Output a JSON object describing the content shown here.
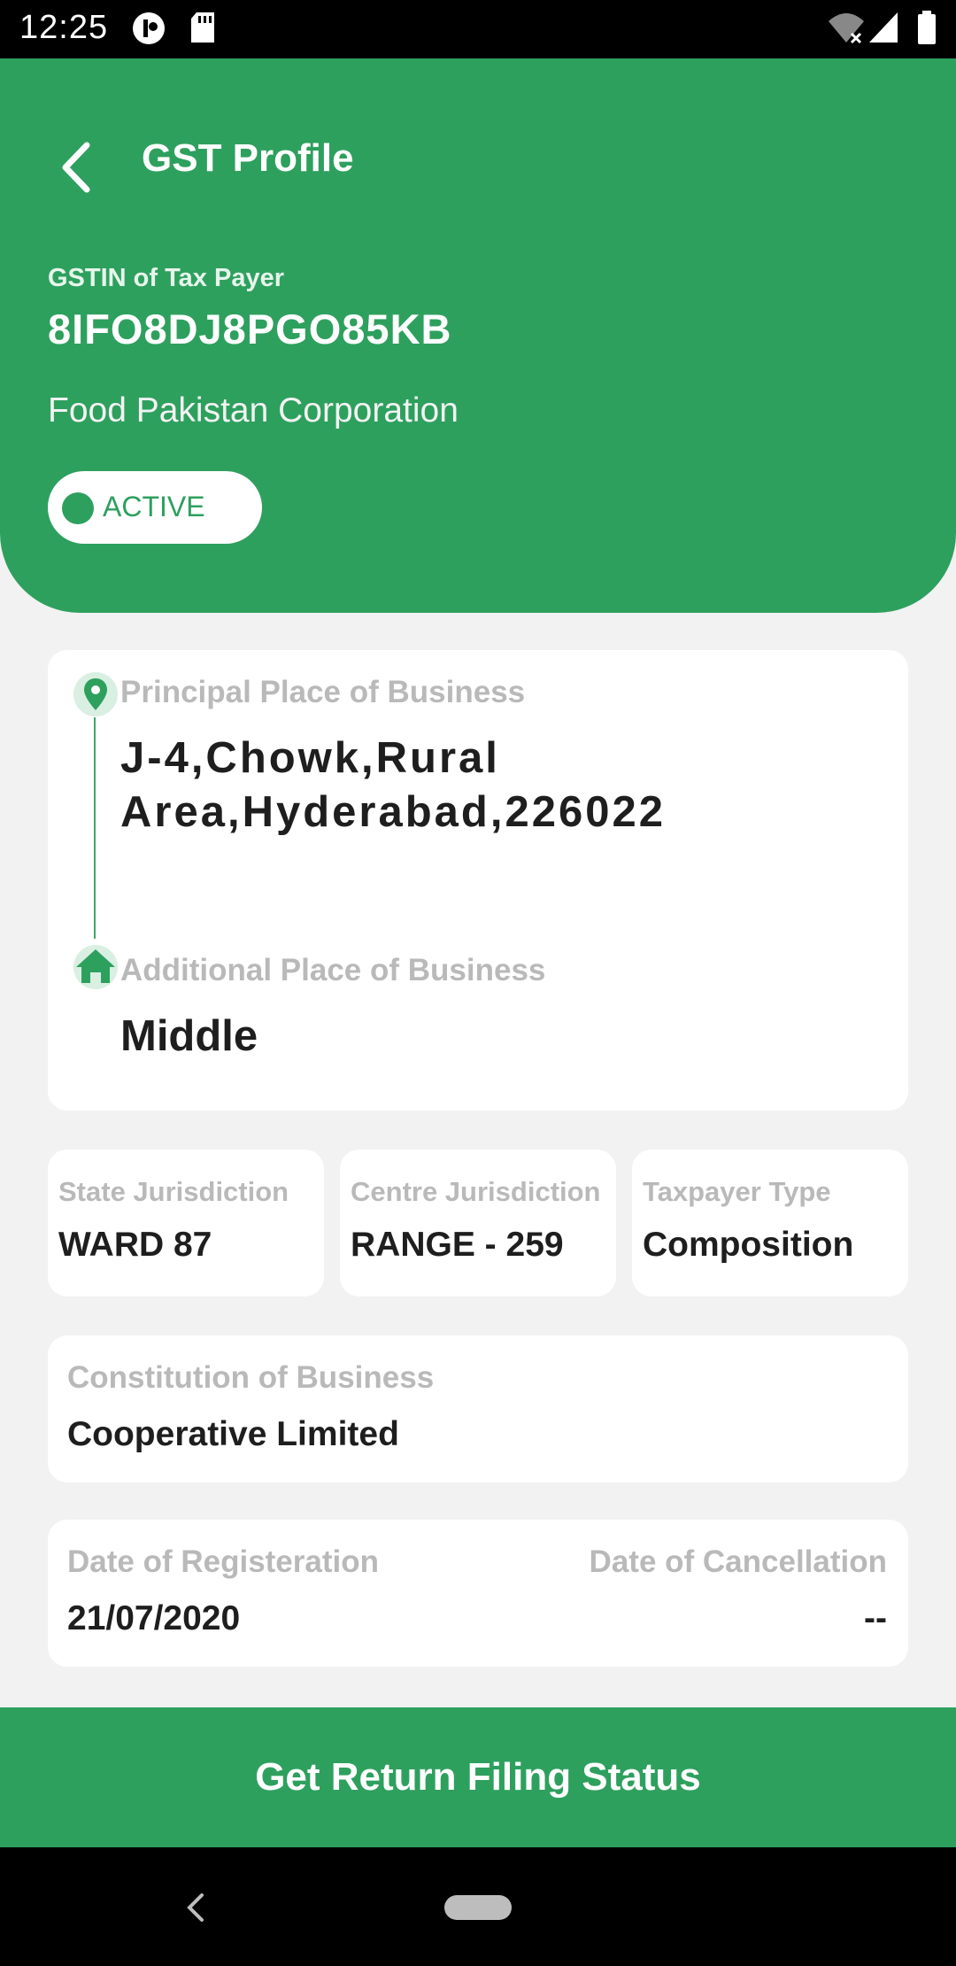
{
  "status_bar": {
    "time": "12:25"
  },
  "header": {
    "title": "GST Profile",
    "gstin_label": "GSTIN of Tax Payer",
    "gstin": "8IFO8DJ8PGO85KB",
    "company_name": "Food Pakistan Corporation",
    "status": "ACTIVE"
  },
  "business": {
    "principal_label": "Principal Place of Business",
    "principal_value": "J-4,Chowk,Rural Area,Hyderabad,226022",
    "additional_label": "Additional Place of Business",
    "additional_value": "Middle"
  },
  "details": {
    "state_label": "State Jurisdiction",
    "state_value": "WARD 87",
    "centre_label": "Centre Jurisdiction",
    "centre_value": "RANGE - 259",
    "taxpayer_label": "Taxpayer Type",
    "taxpayer_value": "Composition",
    "constitution_label": "Constitution of Business",
    "constitution_value": "Cooperative Limited",
    "reg_label": "Date of Registeration",
    "reg_value": "21/07/2020",
    "cancel_label": "Date of Cancellation",
    "cancel_value": "--"
  },
  "cta": {
    "label": "Get Return Filing Status"
  },
  "colors": {
    "brand": "#2ea05e",
    "muted": "#b9b9b9",
    "text": "#1e1e1e"
  },
  "icons": [
    "back-arrow-icon",
    "location-pin-icon",
    "home-icon",
    "wifi-icon",
    "signal-icon",
    "battery-icon"
  ]
}
